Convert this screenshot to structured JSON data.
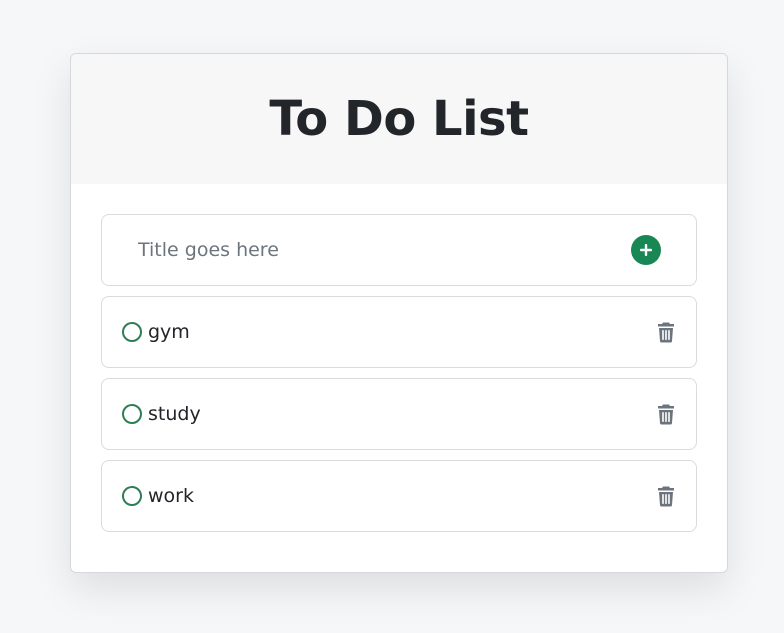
{
  "header": {
    "title": "To Do List"
  },
  "new_task": {
    "placeholder": "Title goes here",
    "value": "",
    "add_icon": "plus-circle-icon"
  },
  "tasks": [
    {
      "label": "gym",
      "completed": false,
      "check_icon": "circle-icon",
      "delete_icon": "trash-icon"
    },
    {
      "label": "study",
      "completed": false,
      "check_icon": "circle-icon",
      "delete_icon": "trash-icon"
    },
    {
      "label": "work",
      "completed": false,
      "check_icon": "circle-icon",
      "delete_icon": "trash-icon"
    }
  ],
  "colors": {
    "accent": "#198754",
    "check_outline": "#2e7d54",
    "trash": "#6c757d",
    "title": "#22252a"
  }
}
